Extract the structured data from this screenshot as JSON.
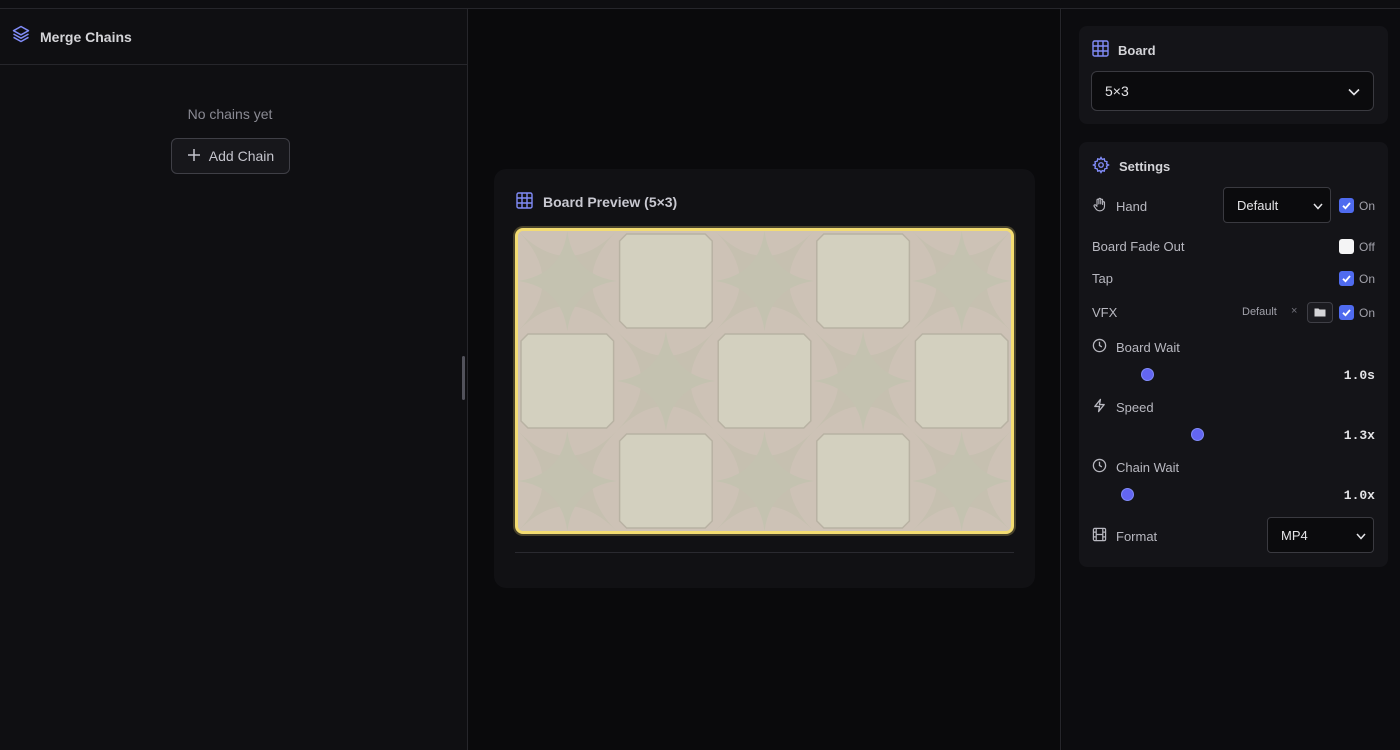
{
  "left": {
    "title": "Merge Chains",
    "empty_text": "No chains yet",
    "add_chain_label": "Add Chain"
  },
  "preview": {
    "title": "Board Preview (5×3)",
    "grid": {
      "cols": 5,
      "rows": 3
    }
  },
  "board": {
    "title": "Board",
    "selected": "5×3"
  },
  "settings": {
    "title": "Settings",
    "hand": {
      "label": "Hand",
      "selected": "Default",
      "toggle_label": "On",
      "checked": true
    },
    "board_fade_out": {
      "label": "Board Fade Out",
      "toggle_label": "Off",
      "checked": false
    },
    "tap": {
      "label": "Tap",
      "toggle_label": "On",
      "checked": true
    },
    "vfx": {
      "label": "VFX",
      "value": "Default",
      "clear": "×",
      "toggle_label": "On",
      "checked": true
    },
    "board_wait": {
      "label": "Board Wait",
      "value": "1.0s",
      "fraction": 0.2
    },
    "speed": {
      "label": "Speed",
      "value": "1.3x",
      "fraction": 0.45
    },
    "chain_wait": {
      "label": "Chain Wait",
      "value": "1.0x",
      "fraction": 0.1
    },
    "format": {
      "label": "Format",
      "selected": "MP4"
    }
  },
  "colors": {
    "accent": "#6366f1",
    "board_highlight": "#f3dc72",
    "tile_light": "#d3d0bf",
    "tile_dark": "#cdc2b6"
  }
}
